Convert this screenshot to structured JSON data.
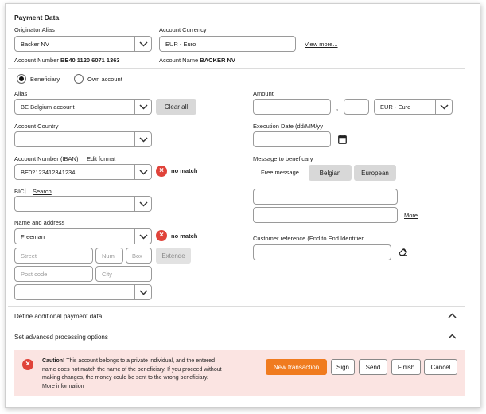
{
  "payment": {
    "title": "Payment Data",
    "originator_alias_label": "Originator Alias",
    "originator_alias_value": "Backer NV",
    "account_currency_label": "Account Currency",
    "account_currency_value": "EUR - Euro",
    "view_more": "View more...",
    "account_number_label": "Account Number",
    "account_number_value": "BE40 1120 6071 1363",
    "account_name_label": "Account Name",
    "account_name_value": "BACKER NV"
  },
  "beneficiary": {
    "radio_beneficiary": "Beneficiary",
    "radio_own_account": "Own account",
    "alias_label": "Alias",
    "alias_value": "BE Belgium account",
    "clear_all": "Clear all",
    "country_label": "Account Country",
    "iban_label": "Account Number (IBAN)",
    "edit_format": "Edit  format",
    "iban_value": "BE02123412341234",
    "iban_status": "no match",
    "bic_label": "BIC",
    "bic_search": "Search",
    "name_address_label": "Name and address",
    "name_value": "Freeman",
    "name_status": "no match",
    "street_placeholder": "Street",
    "num_placeholder": "Num",
    "box_placeholder": "Box",
    "extend": "Extende",
    "postcode_placeholder": "Post code",
    "city_placeholder": "City"
  },
  "right": {
    "amount_label": "Amount",
    "amount_sep": ",",
    "currency_value": "EUR - Euro",
    "exec_date_label": "Execution Date (dd/MM/yy",
    "message_label": "Message to beneficary",
    "tab_free": "Free message",
    "tab_belgian": "Belgian",
    "tab_european": "European",
    "more": "More",
    "customer_ref_label": "Customer reference (End to End Identifier"
  },
  "sections": {
    "additional": "Define additional payment data",
    "advanced": "Set advanced processing options"
  },
  "alert": {
    "caution": "Caution!",
    "line1": " This account belongs to a private individual, and the entered",
    "line2": "name does not match the name of the beneficiary. If you proceed without",
    "line3": "making changes, the money could be sent to the wrong beneficiary.",
    "more_info": "More information"
  },
  "actions": {
    "new_transaction": "New transaction",
    "sign": "Sign",
    "send": "Send",
    "finish": "Finish",
    "cancel": "Cancel"
  },
  "colors": {
    "accent_orange": "#f07b1f",
    "error_red": "#e0433a",
    "alert_bg": "#fbe4e2"
  }
}
